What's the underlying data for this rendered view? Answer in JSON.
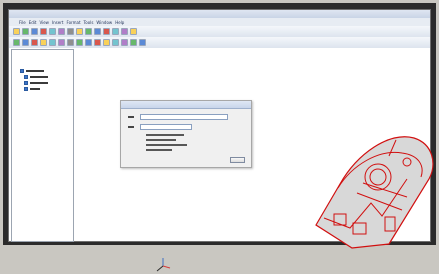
{
  "menu": {
    "items": [
      "File",
      "Edit",
      "View",
      "Insert",
      "Format",
      "Tools",
      "Window",
      "Help"
    ]
  },
  "dialog": {
    "title": "",
    "field_1": "",
    "field_2": "",
    "notes": ""
  },
  "colors": {
    "model_stroke": "#d10f0f",
    "model_fill": "#d8d8d8"
  },
  "icons": {
    "axis": "axis-triad-icon"
  }
}
